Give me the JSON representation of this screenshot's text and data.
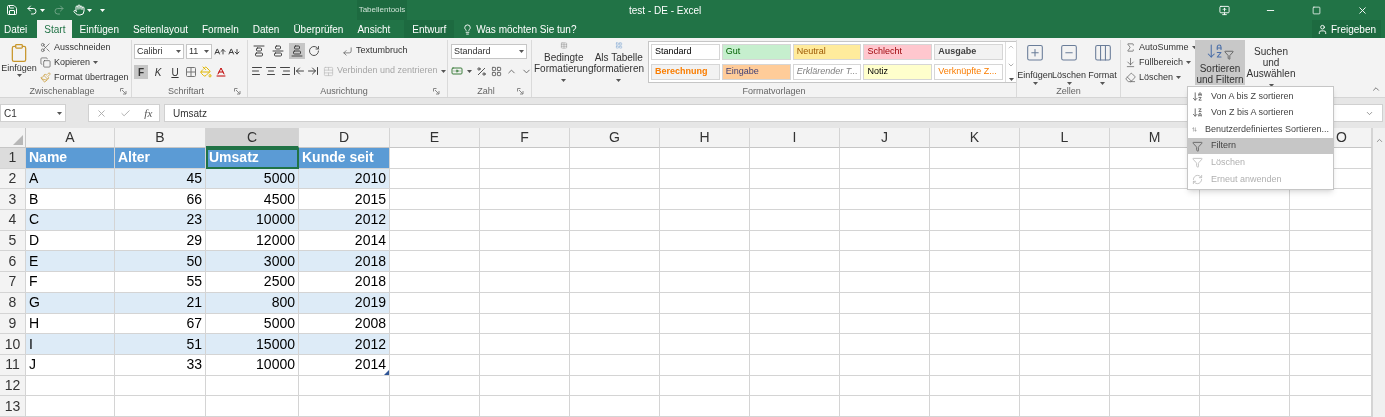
{
  "title_bar": {
    "context_label": "Tabellentools",
    "document_title": "test - DE - Excel"
  },
  "tabs": [
    {
      "label": "Datei",
      "kind": "file",
      "selected": false
    },
    {
      "label": "Start",
      "kind": "tab",
      "selected": true
    },
    {
      "label": "Einfügen",
      "kind": "tab",
      "selected": false
    },
    {
      "label": "Seitenlayout",
      "kind": "tab",
      "selected": false
    },
    {
      "label": "Formeln",
      "kind": "tab",
      "selected": false
    },
    {
      "label": "Daten",
      "kind": "tab",
      "selected": false
    },
    {
      "label": "Überprüfen",
      "kind": "tab",
      "selected": false
    },
    {
      "label": "Ansicht",
      "kind": "tab",
      "selected": false
    },
    {
      "label": "Entwurf",
      "kind": "context",
      "selected": false
    }
  ],
  "tell_me": "Was möchten Sie tun?",
  "share_button": "Freigeben",
  "ribbon": {
    "clipboard": {
      "label": "Zwischenablage",
      "paste": "Einfügen",
      "commands": [
        "Ausschneiden",
        "Kopieren",
        "Format übertragen"
      ]
    },
    "font": {
      "label": "Schriftart",
      "font_name": "Calibri",
      "font_size": "11",
      "styles": [
        {
          "label": "F",
          "selected": true
        },
        {
          "label": "K",
          "selected": false
        },
        {
          "label": "U",
          "selected": false
        }
      ]
    },
    "alignment": {
      "label": "Ausrichtung",
      "vertical": [
        {
          "kind": "top",
          "selected": false
        },
        {
          "kind": "middle",
          "selected": false
        },
        {
          "kind": "bottom",
          "selected": true
        }
      ],
      "wrap": "Textumbruch",
      "merge": {
        "label": "Verbinden und zentrieren",
        "disabled": true
      }
    },
    "number": {
      "label": "Zahl",
      "format": "Standard"
    },
    "styles": {
      "label": "Formatvorlagen",
      "conditional": "Bedingte Formatierung",
      "as_table": "Als Tabelle formatieren",
      "gallery": [
        {
          "label": "Standard",
          "kind": "standard",
          "color": "#ffffff"
        },
        {
          "label": "Gut",
          "kind": "good",
          "color": "#c6efce"
        },
        {
          "label": "Neutral",
          "kind": "neutral",
          "color": "#ffeb9c"
        },
        {
          "label": "Schlecht",
          "kind": "bad",
          "color": "#ffc7ce"
        },
        {
          "label": "Ausgabe",
          "kind": "output",
          "color": "#f2f2f2"
        },
        {
          "label": "Berechnung",
          "kind": "calculation",
          "color": "#f2f2f2"
        },
        {
          "label": "Eingabe",
          "kind": "input",
          "color": "#ffcc99"
        },
        {
          "label": "Erklärender T...",
          "kind": "explanatory",
          "color": "#ffffff"
        },
        {
          "label": "Notiz",
          "kind": "note",
          "color": "#ffffcc"
        },
        {
          "label": "Verknüpfte Z...",
          "kind": "linked",
          "color": "#ffffff"
        }
      ]
    },
    "cells": {
      "label": "Zellen",
      "commands": [
        "Einfügen",
        "Löschen",
        "Format"
      ]
    },
    "editing": {
      "commands": [
        "AutoSumme",
        "Füllbereich",
        "Löschen"
      ],
      "sort_filter": {
        "label": "Sortieren und Filtern",
        "selected": true
      },
      "find": "Suchen und Auswählen"
    }
  },
  "formula_bar": {
    "name_box": "C1",
    "function_label": "fx",
    "formula": "Umsatz"
  },
  "sheet": {
    "columns": [
      {
        "label": "A",
        "selected": false
      },
      {
        "label": "B",
        "selected": false
      },
      {
        "label": "C",
        "selected": true
      },
      {
        "label": "D",
        "selected": false
      },
      {
        "label": "E",
        "selected": false
      },
      {
        "label": "F",
        "selected": false
      },
      {
        "label": "G",
        "selected": false
      },
      {
        "label": "H",
        "selected": false
      },
      {
        "label": "I",
        "selected": false
      },
      {
        "label": "J",
        "selected": false
      },
      {
        "label": "K",
        "selected": false
      },
      {
        "label": "L",
        "selected": false
      },
      {
        "label": "M",
        "selected": false
      },
      {
        "label": "O",
        "selected": false
      }
    ],
    "rows": [
      {
        "label": "1",
        "selected": true,
        "cells": [
          {
            "text": "Name",
            "selected": false
          },
          {
            "text": "Alter",
            "selected": false
          },
          {
            "text": "Umsatz",
            "selected": true
          },
          {
            "text": "Kunde seit",
            "selected": false
          }
        ]
      },
      {
        "label": "2",
        "selected": false,
        "cells": [
          {
            "text": "A",
            "selected": false
          },
          {
            "text": "45",
            "selected": false
          },
          {
            "text": "5000",
            "selected": false
          },
          {
            "text": "2010",
            "selected": false
          }
        ]
      },
      {
        "label": "3",
        "selected": false,
        "cells": [
          {
            "text": "B",
            "selected": false
          },
          {
            "text": "66",
            "selected": false
          },
          {
            "text": "4500",
            "selected": false
          },
          {
            "text": "2015",
            "selected": false
          }
        ]
      },
      {
        "label": "4",
        "selected": false,
        "cells": [
          {
            "text": "C",
            "selected": false
          },
          {
            "text": "23",
            "selected": false
          },
          {
            "text": "10000",
            "selected": false
          },
          {
            "text": "2012",
            "selected": false
          }
        ]
      },
      {
        "label": "5",
        "selected": false,
        "cells": [
          {
            "text": "D",
            "selected": false
          },
          {
            "text": "29",
            "selected": false
          },
          {
            "text": "12000",
            "selected": false
          },
          {
            "text": "2014",
            "selected": false
          }
        ]
      },
      {
        "label": "6",
        "selected": false,
        "cells": [
          {
            "text": "E",
            "selected": false
          },
          {
            "text": "50",
            "selected": false
          },
          {
            "text": "3000",
            "selected": false
          },
          {
            "text": "2018",
            "selected": false
          }
        ]
      },
      {
        "label": "7",
        "selected": false,
        "cells": [
          {
            "text": "F",
            "selected": false
          },
          {
            "text": "55",
            "selected": false
          },
          {
            "text": "2500",
            "selected": false
          },
          {
            "text": "2018",
            "selected": false
          }
        ]
      },
      {
        "label": "8",
        "selected": false,
        "cells": [
          {
            "text": "G",
            "selected": false
          },
          {
            "text": "21",
            "selected": false
          },
          {
            "text": "800",
            "selected": false
          },
          {
            "text": "2019",
            "selected": false
          }
        ]
      },
      {
        "label": "9",
        "selected": false,
        "cells": [
          {
            "text": "H",
            "selected": false
          },
          {
            "text": "67",
            "selected": false
          },
          {
            "text": "5000",
            "selected": false
          },
          {
            "text": "2008",
            "selected": false
          }
        ]
      },
      {
        "label": "10",
        "selected": false,
        "cells": [
          {
            "text": "I",
            "selected": false
          },
          {
            "text": "51",
            "selected": false
          },
          {
            "text": "15000",
            "selected": false
          },
          {
            "text": "2012",
            "selected": false
          }
        ]
      },
      {
        "label": "11",
        "selected": false,
        "cells": [
          {
            "text": "J",
            "selected": false
          },
          {
            "text": "33",
            "selected": false
          },
          {
            "text": "10000",
            "selected": false
          },
          {
            "text": "2014",
            "selected": false
          }
        ]
      },
      {
        "label": "12",
        "selected": false
      },
      {
        "label": "13",
        "selected": false
      }
    ]
  },
  "menu": {
    "items": [
      {
        "kind": "sort-asc",
        "label": "Von A bis Z sortieren",
        "selected": false,
        "disabled": false
      },
      {
        "kind": "sort-desc",
        "label": "Von Z bis A sortieren",
        "selected": false,
        "disabled": false
      },
      {
        "kind": "custom-sort",
        "label": "Benutzerdefiniertes Sortieren...",
        "selected": false,
        "disabled": false
      },
      {
        "kind": "filter",
        "label": "Filtern",
        "selected": true,
        "disabled": false
      },
      {
        "kind": "clear",
        "label": "Löschen",
        "selected": false,
        "disabled": true
      },
      {
        "kind": "reapply",
        "label": "Erneut anwenden",
        "selected": false,
        "disabled": true
      }
    ]
  }
}
